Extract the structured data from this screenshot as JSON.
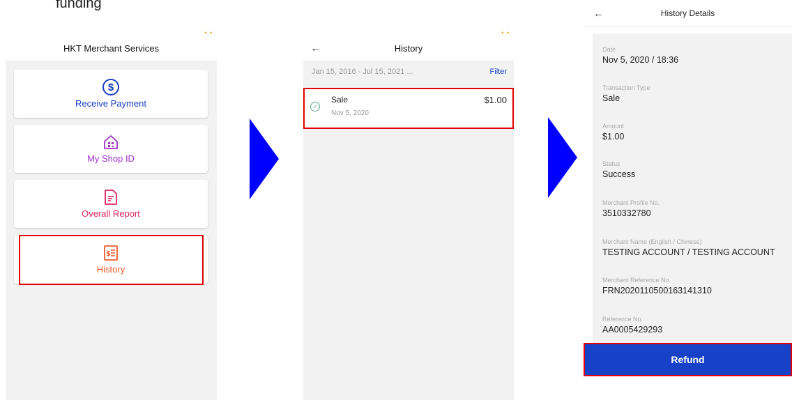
{
  "caption": "funding",
  "screen1": {
    "title": "HKT Merchant Services",
    "status_indicator": "• •",
    "cards": [
      {
        "label": "Receive Payment",
        "icon": "dollar-circle-icon",
        "color": "#1b3fc4"
      },
      {
        "label": "My Shop ID",
        "icon": "shop-qr-icon",
        "color": "#a030c8"
      },
      {
        "label": "Overall Report",
        "icon": "report-document-icon",
        "color": "#e0245e"
      },
      {
        "label": "History",
        "icon": "receipt-list-icon",
        "color": "#f05a28"
      }
    ]
  },
  "screen2": {
    "title": "History",
    "status_indicator": "• •",
    "date_range": "Jan 15, 2016 - Jul 15, 2021 ...",
    "filter_label": "Filter",
    "transactions": [
      {
        "type": "Sale",
        "date": "Nov 5, 2020",
        "amount": "$1.00"
      }
    ]
  },
  "screen3": {
    "title": "History Details",
    "fields": [
      {
        "key": "Date",
        "value": "Nov 5, 2020 / 18:36"
      },
      {
        "key": "Transaction Type",
        "value": "Sale"
      },
      {
        "key": "Amount",
        "value": "$1.00"
      },
      {
        "key": "Status",
        "value": "Success"
      },
      {
        "key": "Merchant Profile No.",
        "value": "3510332780"
      },
      {
        "key": "Merchant Name (English / Chinese)",
        "value": "TESTING ACCOUNT / TESTING ACCOUNT"
      },
      {
        "key": "Merchant Reference No.",
        "value": "FRN2020110500163141310"
      },
      {
        "key": "Reference No.",
        "value": "AA0005429293"
      }
    ],
    "refund_label": "Refund"
  },
  "colors": {
    "accent_blue": "#1742c8",
    "highlight_red": "#e00000",
    "arrow_blue": "#0000ff"
  }
}
